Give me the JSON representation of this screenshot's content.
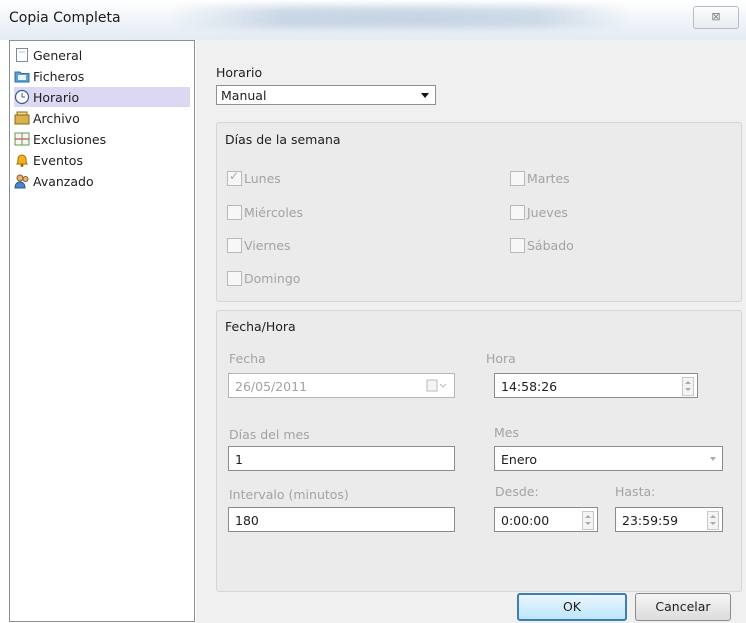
{
  "window": {
    "title": "Copia Completa",
    "close_glyph": "⊠"
  },
  "sidebar": {
    "items": [
      {
        "label": "General",
        "icon": "page-icon"
      },
      {
        "label": "Ficheros",
        "icon": "folder-icon"
      },
      {
        "label": "Horario",
        "icon": "clock-icon",
        "selected": true
      },
      {
        "label": "Archivo",
        "icon": "archive-icon"
      },
      {
        "label": "Exclusiones",
        "icon": "exclusions-icon"
      },
      {
        "label": "Eventos",
        "icon": "bell-icon"
      },
      {
        "label": "Avanzado",
        "icon": "users-icon"
      }
    ],
    "selected_color": "#dcd8f4"
  },
  "schedule": {
    "label": "Horario",
    "value": "Manual"
  },
  "weekdays": {
    "legend": "Días de la semana",
    "days": [
      {
        "label": "Lunes",
        "checked": true
      },
      {
        "label": "Martes",
        "checked": false
      },
      {
        "label": "Miércoles",
        "checked": false
      },
      {
        "label": "Jueves",
        "checked": false
      },
      {
        "label": "Viernes",
        "checked": false
      },
      {
        "label": "Sábado",
        "checked": false
      },
      {
        "label": "Domingo",
        "checked": false
      }
    ]
  },
  "datetime": {
    "legend": "Fecha/Hora",
    "fecha": {
      "label": "Fecha",
      "value": "26/05/2011"
    },
    "hora": {
      "label": "Hora",
      "value": "14:58:26"
    },
    "dias_mes": {
      "label": "Días del mes",
      "value": "1"
    },
    "mes": {
      "label": "Mes",
      "value": "Enero"
    },
    "intervalo": {
      "label": "Intervalo (minutos)",
      "value": "180"
    },
    "desde": {
      "label": "Desde:",
      "value": "0:00:00"
    },
    "hasta": {
      "label": "Hasta:",
      "value": "23:59:59"
    }
  },
  "buttons": {
    "ok": "OK",
    "cancel": "Cancelar"
  },
  "colors": {
    "accent_border": "#3c7fb1",
    "disabled_text": "#a3a3a3"
  }
}
